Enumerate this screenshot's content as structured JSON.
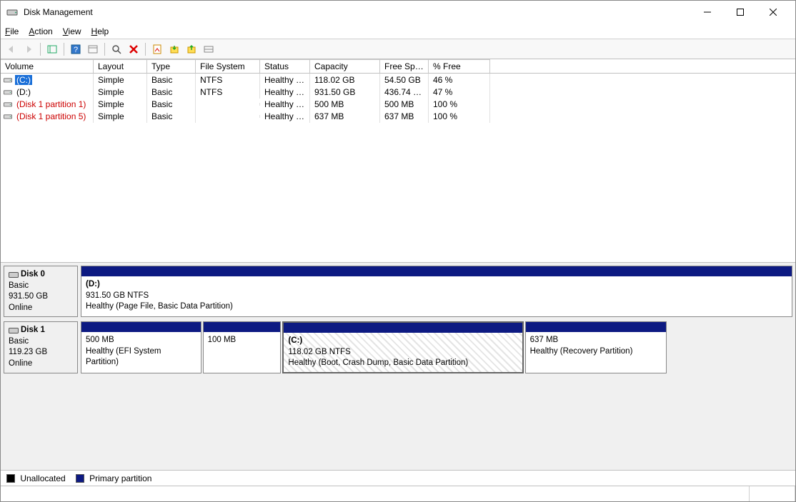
{
  "window": {
    "title": "Disk Management"
  },
  "menu": {
    "file": "File",
    "action": "Action",
    "view": "View",
    "help": "Help"
  },
  "columns": {
    "volume": "Volume",
    "layout": "Layout",
    "type": "Type",
    "filesystem": "File System",
    "status": "Status",
    "capacity": "Capacity",
    "freespace": "Free Spa...",
    "pctfree": "% Free"
  },
  "volumes": [
    {
      "name": "(C:)",
      "layout": "Simple",
      "type": "Basic",
      "fs": "NTFS",
      "status": "Healthy (B...",
      "capacity": "118.02 GB",
      "free": "54.50 GB",
      "pct": "46 %",
      "selected": true
    },
    {
      "name": "(D:)",
      "layout": "Simple",
      "type": "Basic",
      "fs": "NTFS",
      "status": "Healthy (P...",
      "capacity": "931.50 GB",
      "free": "436.74 GB",
      "pct": "47 %",
      "selected": false
    },
    {
      "name": "(Disk 1 partition 1)",
      "red": true,
      "layout": "Simple",
      "type": "Basic",
      "fs": "",
      "status": "Healthy (E...",
      "capacity": "500 MB",
      "free": "500 MB",
      "pct": "100 %",
      "selected": false
    },
    {
      "name": "(Disk 1 partition 5)",
      "red": true,
      "layout": "Simple",
      "type": "Basic",
      "fs": "",
      "status": "Healthy (R...",
      "capacity": "637 MB",
      "free": "637 MB",
      "pct": "100 %",
      "selected": false
    }
  ],
  "disks": [
    {
      "label": "Disk 0",
      "type": "Basic",
      "size": "931.50 GB",
      "state": "Online",
      "parts": [
        {
          "title": "(D:)",
          "line2": "931.50 GB NTFS",
          "line3": "Healthy (Page File, Basic Data Partition)",
          "flex": 1
        }
      ]
    },
    {
      "label": "Disk 1",
      "type": "Basic",
      "size": "119.23 GB",
      "state": "Online",
      "parts": [
        {
          "title": "",
          "line2": "500 MB",
          "line3": "Healthy (EFI System Partition)",
          "flex": 0.17
        },
        {
          "title": "",
          "line2": "100 MB",
          "line3": "",
          "flex": 0.11
        },
        {
          "title": "(C:)",
          "line2": "118.02 GB NTFS",
          "line3": "Healthy (Boot, Crash Dump, Basic Data Partition)",
          "flex": 0.34,
          "selected": true
        },
        {
          "title": "",
          "line2": "637 MB",
          "line3": "Healthy (Recovery Partition)",
          "flex": 0.2
        }
      ]
    }
  ],
  "legend": {
    "unallocated": "Unallocated",
    "primary": "Primary partition"
  },
  "colors": {
    "primary_stripe": "#0d1a82",
    "unallocated": "#000000",
    "selection": "#1a6fd8"
  }
}
